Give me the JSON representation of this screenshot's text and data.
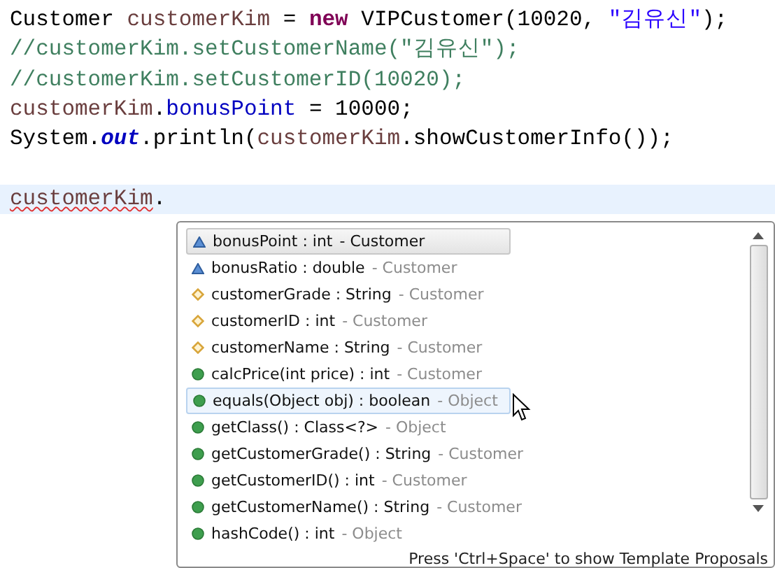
{
  "code_lines": [
    {
      "tokens": [
        {
          "kind": "plain",
          "text": "Customer "
        },
        {
          "kind": "var",
          "text": "customerKim"
        },
        {
          "kind": "plain",
          "text": " = "
        },
        {
          "kind": "keyword",
          "text": "new"
        },
        {
          "kind": "plain",
          "text": " VIPCustomer(10020, "
        },
        {
          "kind": "string",
          "text": "\"김유신\""
        },
        {
          "kind": "plain",
          "text": ");"
        }
      ]
    },
    {
      "tokens": [
        {
          "kind": "comment",
          "text": "//customerKim.setCustomerName(\"김유신\");"
        }
      ]
    },
    {
      "tokens": [
        {
          "kind": "comment",
          "text": "//customerKim.setCustomerID(10020);"
        }
      ]
    },
    {
      "tokens": [
        {
          "kind": "var",
          "text": "customerKim"
        },
        {
          "kind": "plain",
          "text": "."
        },
        {
          "kind": "field",
          "text": "bonusPoint"
        },
        {
          "kind": "plain",
          "text": " = 10000;"
        }
      ]
    },
    {
      "tokens": [
        {
          "kind": "plain",
          "text": "System."
        },
        {
          "kind": "static",
          "text": "out"
        },
        {
          "kind": "plain",
          "text": ".println("
        },
        {
          "kind": "var",
          "text": "customerKim"
        },
        {
          "kind": "plain",
          "text": ".showCustomerInfo());"
        }
      ]
    },
    {
      "current": true,
      "tokens": [
        {
          "kind": "var",
          "text": "customerKim",
          "error": true
        },
        {
          "kind": "plain",
          "text": "."
        }
      ]
    }
  ],
  "proposals": [
    {
      "kind": "protected-field",
      "signature": "bonusPoint : int",
      "owner": "- Customer",
      "selected": true,
      "hovered": false
    },
    {
      "kind": "protected-field",
      "signature": "bonusRatio : double",
      "owner": "- Customer",
      "selected": false,
      "hovered": false
    },
    {
      "kind": "package-field",
      "signature": "customerGrade : String",
      "owner": "- Customer",
      "selected": false,
      "hovered": false
    },
    {
      "kind": "package-field",
      "signature": "customerID : int",
      "owner": "- Customer",
      "selected": false,
      "hovered": false
    },
    {
      "kind": "package-field",
      "signature": "customerName : String",
      "owner": "- Customer",
      "selected": false,
      "hovered": false
    },
    {
      "kind": "method",
      "signature": "calcPrice(int price) : int",
      "owner": "- Customer",
      "selected": false,
      "hovered": false
    },
    {
      "kind": "method",
      "signature": "equals(Object obj) : boolean",
      "owner": "- Object",
      "selected": false,
      "hovered": true
    },
    {
      "kind": "method",
      "signature": "getClass() : Class<?>",
      "owner": "- Object",
      "selected": false,
      "hovered": false
    },
    {
      "kind": "method",
      "signature": "getCustomerGrade() : String",
      "owner": "- Customer",
      "selected": false,
      "hovered": false
    },
    {
      "kind": "method",
      "signature": "getCustomerID() : int",
      "owner": "- Customer",
      "selected": false,
      "hovered": false
    },
    {
      "kind": "method",
      "signature": "getCustomerName() : String",
      "owner": "- Customer",
      "selected": false,
      "hovered": false
    },
    {
      "kind": "method",
      "signature": "hashCode() : int",
      "owner": "- Object",
      "selected": false,
      "hovered": false
    }
  ],
  "footer": "Press 'Ctrl+Space' to show Template Proposals"
}
